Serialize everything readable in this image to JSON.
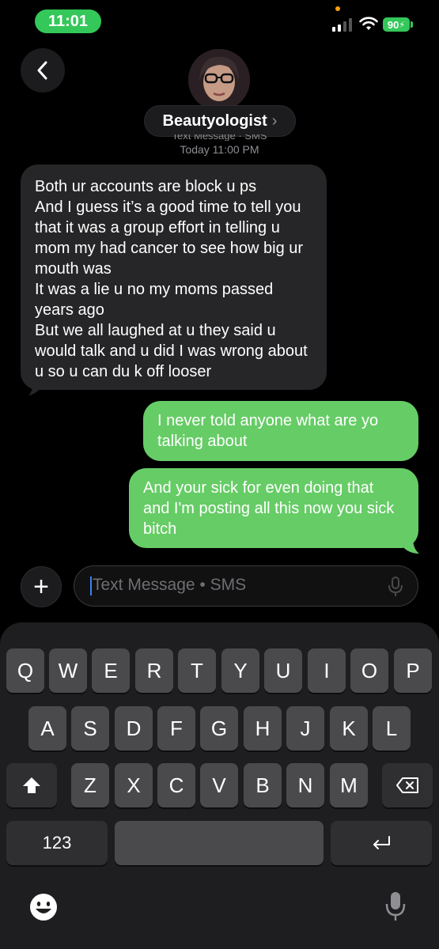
{
  "status_bar": {
    "time": "11:01",
    "battery": "90",
    "accent_green": "#34c759"
  },
  "header": {
    "contact_name": "Beautyologist",
    "chevron": "›",
    "service_label": "Text Message · SMS",
    "timestamp": "Today 11:00 PM"
  },
  "messages": [
    {
      "direction": "incoming",
      "text": "Both ur accounts are block u ps\nAnd I guess it’s a good time to tell you that it was a group effort in telling u mom my had cancer to see how big ur mouth was\nIt was a lie u no my moms passed years ago\nBut we all laughed at u they said u would talk and u did I was wrong about u so u can du k off looser"
    },
    {
      "direction": "outgoing",
      "text": "I never told anyone what are yo talking about"
    },
    {
      "direction": "outgoing",
      "text": "And your sick for even doing that and I'm posting all this now you sick bitch"
    }
  ],
  "composer": {
    "plus_label": "+",
    "placeholder": "Text Message • SMS"
  },
  "keyboard": {
    "row1": [
      "Q",
      "W",
      "E",
      "R",
      "T",
      "Y",
      "U",
      "I",
      "O",
      "P"
    ],
    "row2": [
      "A",
      "S",
      "D",
      "F",
      "G",
      "H",
      "J",
      "K",
      "L"
    ],
    "row3": [
      "Z",
      "X",
      "C",
      "V",
      "B",
      "N",
      "M"
    ],
    "numbers_label": "123",
    "space_label": "",
    "bubble_color_outgoing": "#66cc66",
    "bubble_color_incoming": "#262628"
  }
}
